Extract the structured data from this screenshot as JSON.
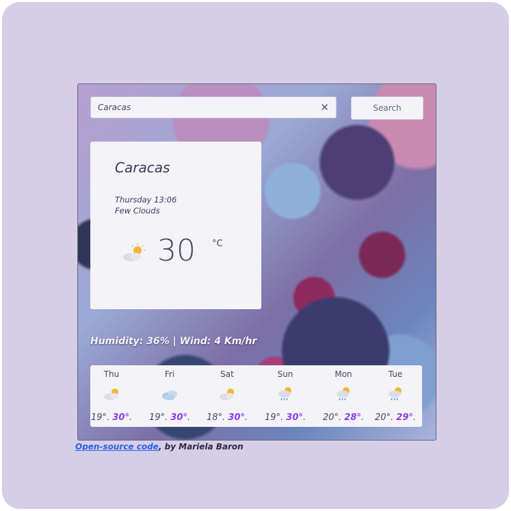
{
  "search": {
    "value": "Caracas",
    "clear_icon": "close-icon",
    "button_label": "Search"
  },
  "current": {
    "city": "Caracas",
    "date": "Thursday 13:06",
    "condition": "Few Clouds",
    "icon": "partly-cloudy-icon",
    "temperature": "30",
    "unit": "°C"
  },
  "details": {
    "text": "Humidity: 36% | Wind: 4 Km/hr"
  },
  "forecast": [
    {
      "day": "Thu",
      "icon": "partly-cloudy-icon",
      "min": "19°",
      "max": "30°"
    },
    {
      "day": "Fri",
      "icon": "cloudy-icon",
      "min": "19°",
      "max": "30°"
    },
    {
      "day": "Sat",
      "icon": "partly-cloudy-icon",
      "min": "18°",
      "max": "30°"
    },
    {
      "day": "Sun",
      "icon": "sun-rain-icon",
      "min": "19°",
      "max": "30°"
    },
    {
      "day": "Mon",
      "icon": "sun-rain-icon",
      "min": "20°",
      "max": "28°"
    },
    {
      "day": "Tue",
      "icon": "sun-rain-icon",
      "min": "20°",
      "max": "29°"
    }
  ],
  "credit": {
    "link_text": "Open-source code",
    "suffix": ", by Mariela Baron"
  },
  "colors": {
    "page_background": "#d6cde6",
    "card_background": "#f4f3f8",
    "max_temp": "#8a3df0",
    "link": "#2a5fe8"
  }
}
